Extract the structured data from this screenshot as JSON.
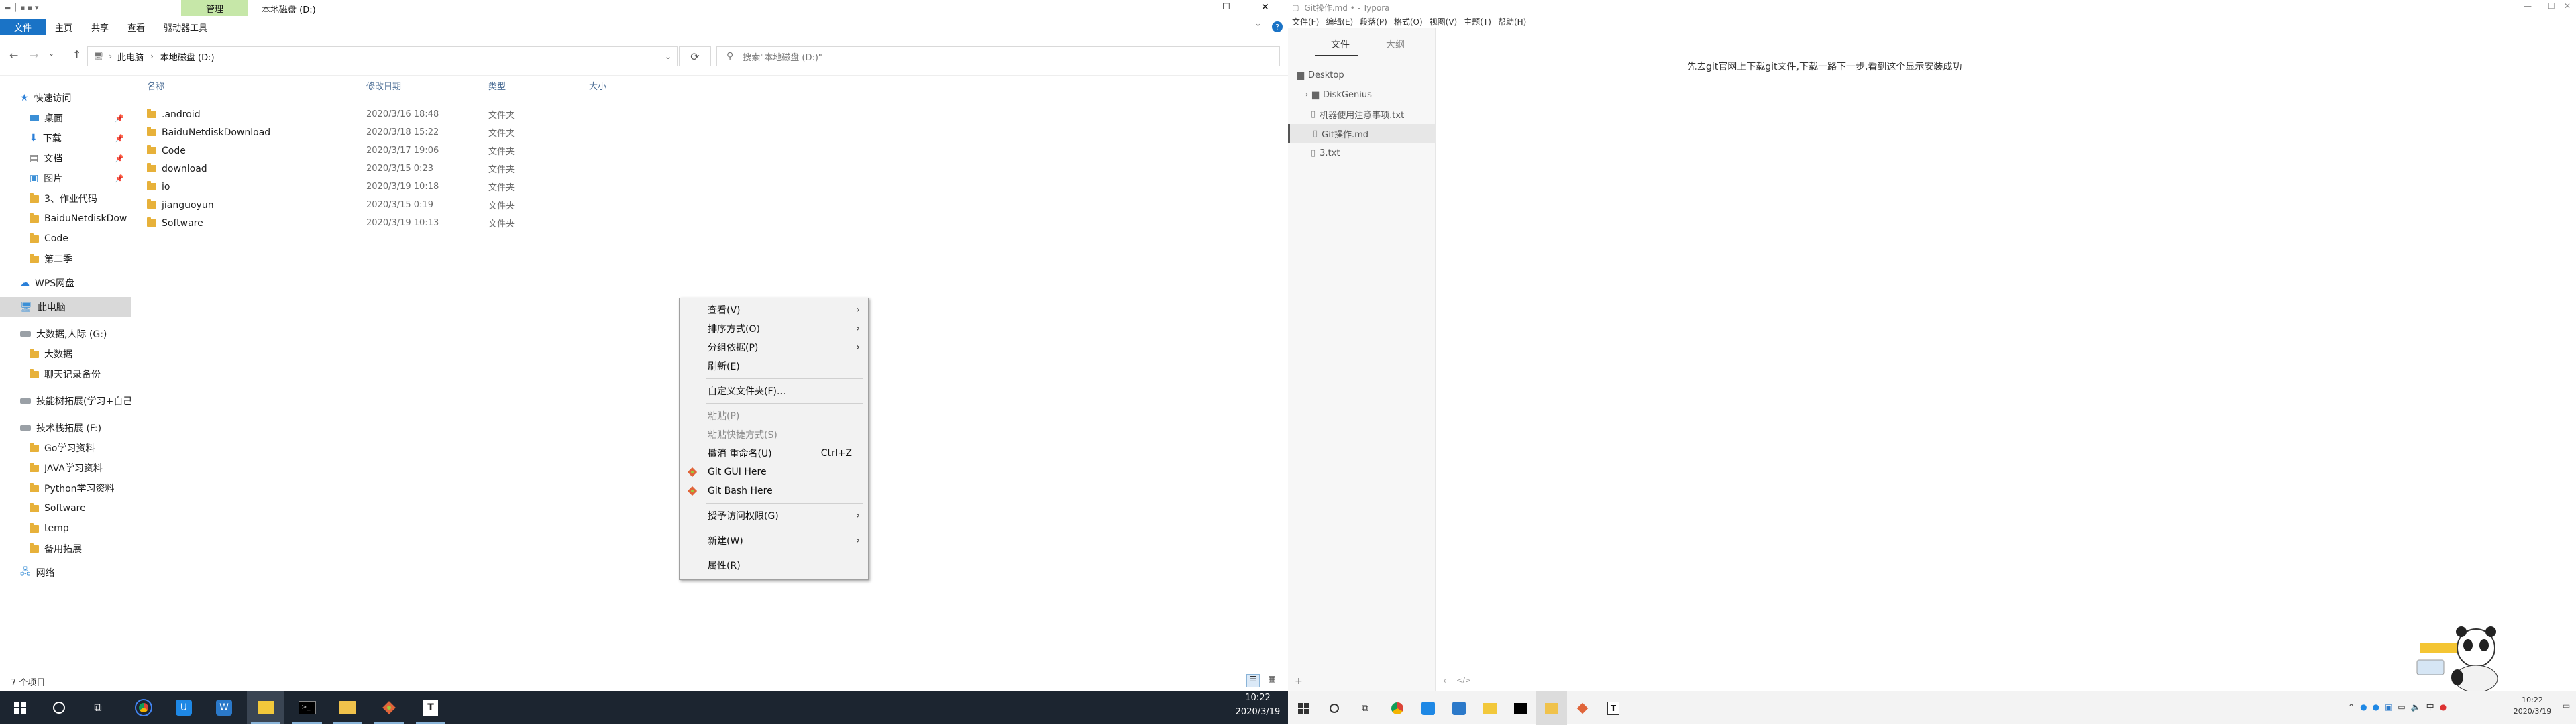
{
  "explorer": {
    "titlebar": {
      "context_tab": "管理",
      "title": "本地磁盘 (D:)",
      "min": "—",
      "max": "☐",
      "close": "✕"
    },
    "ribbon": {
      "tabs": [
        "文件",
        "主页",
        "共享",
        "查看",
        "驱动器工具"
      ],
      "help": "?"
    },
    "address": {
      "breadcrumb": [
        "此电脑",
        "本地磁盘 (D:)"
      ],
      "search_placeholder": "搜索\"本地磁盘 (D:)\""
    },
    "columns": {
      "name": "名称",
      "date": "修改日期",
      "type": "类型",
      "size": "大小"
    },
    "files": [
      {
        "name": ".android",
        "date": "2020/3/16 18:48",
        "type": "文件夹"
      },
      {
        "name": "BaiduNetdiskDownload",
        "date": "2020/3/18 15:22",
        "type": "文件夹"
      },
      {
        "name": "Code",
        "date": "2020/3/17 19:06",
        "type": "文件夹"
      },
      {
        "name": "download",
        "date": "2020/3/15 0:23",
        "type": "文件夹"
      },
      {
        "name": "io",
        "date": "2020/3/19 10:18",
        "type": "文件夹"
      },
      {
        "name": "jianguoyun",
        "date": "2020/3/15 0:19",
        "type": "文件夹"
      },
      {
        "name": "Software",
        "date": "2020/3/19 10:13",
        "type": "文件夹"
      }
    ],
    "nav": {
      "quick_access": "快速访问",
      "quick_items": [
        "桌面",
        "下载",
        "文档",
        "图片",
        "3、作业代码",
        "BaiduNetdiskDow",
        "Code",
        "第二季"
      ],
      "wps": "WPS网盘",
      "this_pc": "此电脑",
      "drive_g": "大数据,人际 (G:)",
      "g_items": [
        "大数据",
        "聊天记录备份"
      ],
      "drive_e": "技能树拓展(学习+自己)",
      "drive_f": "技术栈拓展 (F:)",
      "f_items": [
        "Go学习资料",
        "JAVA学习资料",
        "Python学习资料",
        "Software",
        "temp",
        "备用拓展"
      ],
      "network": "网络"
    },
    "status": "7 个项目"
  },
  "context_menu": {
    "items": [
      {
        "label": "查看(V)",
        "arrow": "›"
      },
      {
        "label": "排序方式(O)",
        "arrow": "›"
      },
      {
        "label": "分组依据(P)",
        "arrow": "›"
      },
      {
        "label": "刷新(E)"
      },
      {
        "label": "自定义文件夹(F)..."
      },
      {
        "label": "粘贴(P)"
      },
      {
        "label": "粘贴快捷方式(S)"
      },
      {
        "label": "撤消 重命名(U)",
        "shortcut": "Ctrl+Z"
      },
      {
        "label": "Git GUI Here"
      },
      {
        "label": "Git Bash Here"
      },
      {
        "label": "授予访问权限(G)",
        "arrow": "›"
      },
      {
        "label": "新建(W)",
        "arrow": "›"
      },
      {
        "label": "属性(R)"
      }
    ]
  },
  "taskbar_left": {
    "time": "10:22",
    "date": "2020/3/19"
  },
  "typora": {
    "title": "Git操作.md • - Typora",
    "menu": [
      "文件(F)",
      "编辑(E)",
      "段落(P)",
      "格式(O)",
      "视图(V)",
      "主题(T)",
      "帮助(H)"
    ],
    "side_tabs": [
      "文件",
      "大纲"
    ],
    "tree": [
      "Desktop",
      "DiskGenius",
      "机器使用注意事项.txt",
      "Git操作.md",
      "3.txt"
    ],
    "body_text": "先去git官网上下载git文件,下载一路下一步,看到这个显示安装成功",
    "bottom_icons": [
      "+",
      "‹",
      "</>"
    ]
  },
  "taskbar_right": {
    "tray": "中",
    "time": "10:22",
    "date": "2020/3/19"
  },
  "colors": {
    "accent": "#1a73c6",
    "taskbar": "#1c2530",
    "folder": "#e7b13a",
    "manage_tab": "#c6e7a8"
  }
}
